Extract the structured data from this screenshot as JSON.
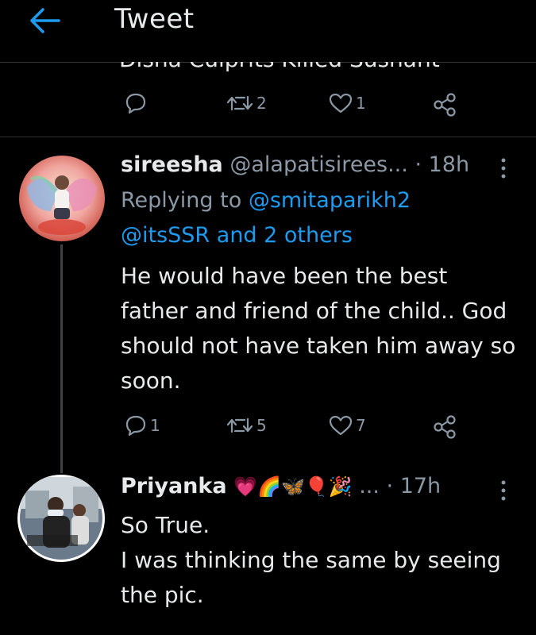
{
  "header": {
    "title": "Tweet",
    "back_icon": "arrow-left-icon",
    "accent": "#1d9bf0"
  },
  "previous_tweet": {
    "clipped_text": "Disha Culprits Killed Sushant",
    "actions": {
      "reply_count": "",
      "retweet_count": "2",
      "like_count": "1"
    }
  },
  "reply1": {
    "name": "sireesha",
    "handle": "@alapatisirees...",
    "time": "· 18h",
    "replying_prefix": "Replying to",
    "replying_to_1": "@smitaparikh2",
    "replying_to_2": "@itsSSR and 2 others",
    "text": "He would have been the best father and friend of the child.. God should not have taken him away so soon.",
    "actions": {
      "reply_count": "1",
      "retweet_count": "5",
      "like_count": "7"
    }
  },
  "reply2": {
    "name": "Priyanka",
    "emojis": "💗🌈🦋🎈🎉",
    "name_ellipsis": "...",
    "time": "· 17h",
    "line1": "So True.",
    "text": "I was thinking the same by seeing the pic."
  },
  "colors": {
    "background": "#000000",
    "text": "#e7e9ea",
    "secondary": "#8b98a5",
    "link": "#1d9bf0",
    "divider": "#2f3336"
  }
}
